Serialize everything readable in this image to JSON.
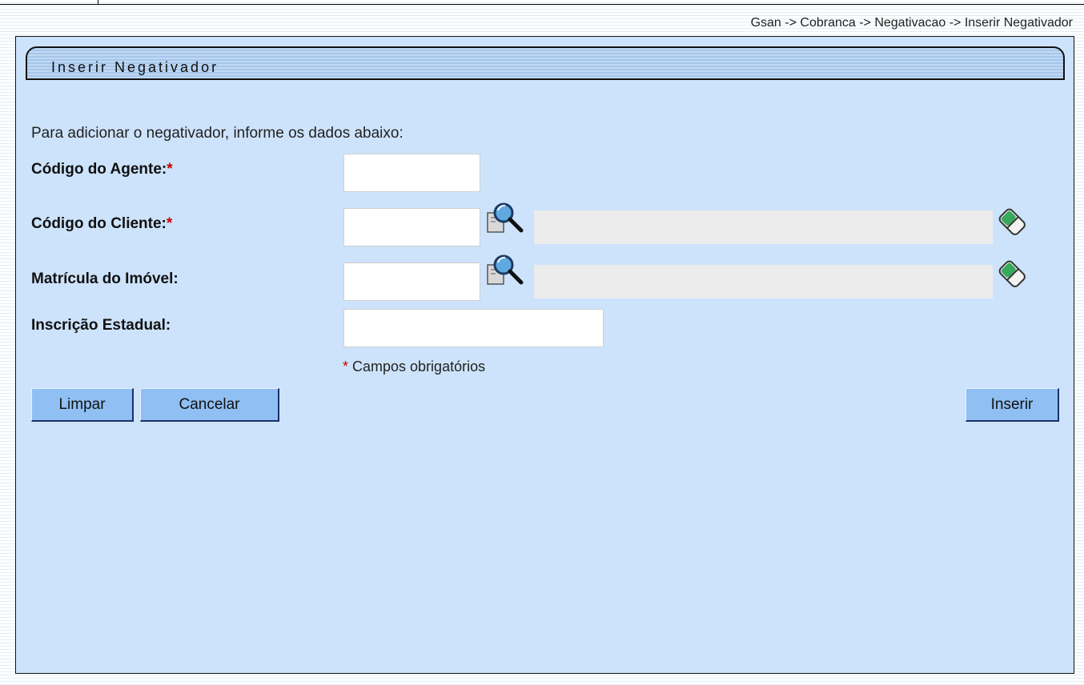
{
  "breadcrumb": "Gsan -> Cobranca -> Negativacao -> Inserir Negativador",
  "panel": {
    "title": "Inserir Negativador",
    "instruction": "Para adicionar o negativador, informe os dados abaixo:"
  },
  "form": {
    "agent_code": {
      "label": "Código do Agente:",
      "required_mark": "*",
      "value": ""
    },
    "client_code": {
      "label": "Código do Cliente:",
      "required_mark": "*",
      "value": "",
      "description": "",
      "search_icon": "magnifier-search-icon",
      "clear_icon": "eraser-icon"
    },
    "property_registration": {
      "label": "Matrícula do Imóvel:",
      "value": "",
      "description": "",
      "search_icon": "magnifier-search-icon",
      "clear_icon": "eraser-icon"
    },
    "state_registration": {
      "label": "Inscrição Estadual:",
      "value": ""
    },
    "required_note": {
      "mark": "*",
      "text": " Campos obrigatórios"
    }
  },
  "buttons": {
    "clear": "Limpar",
    "cancel": "Cancelar",
    "insert": "Inserir"
  },
  "colors": {
    "panel_background": "#cde3fb",
    "button_background": "#8fbff3",
    "required_mark": "#d00000"
  }
}
